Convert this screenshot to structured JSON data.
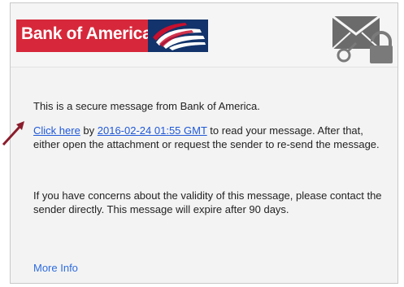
{
  "brand": {
    "logo_text": "Bank of America",
    "logo_icon": "bank-flag-logo",
    "colors": {
      "red": "#d6283a",
      "navy": "#12336b"
    }
  },
  "header_icon": "secure-mail-lock-icon",
  "message": {
    "line1": "This is a secure message from Bank of America.",
    "link_text": "Click here",
    "by_text": " by ",
    "date_link": "2016-02-24 01:55 GMT",
    "after_date": " to read your message. After that, either open the attachment or request the sender to re-send the message.",
    "paragraph3": "If you have concerns about the validity of this message, please contact the sender directly. This message will expire after 90 days.",
    "more_info": "More Info"
  },
  "annotation": {
    "arrow_color": "#8b1d2c"
  }
}
